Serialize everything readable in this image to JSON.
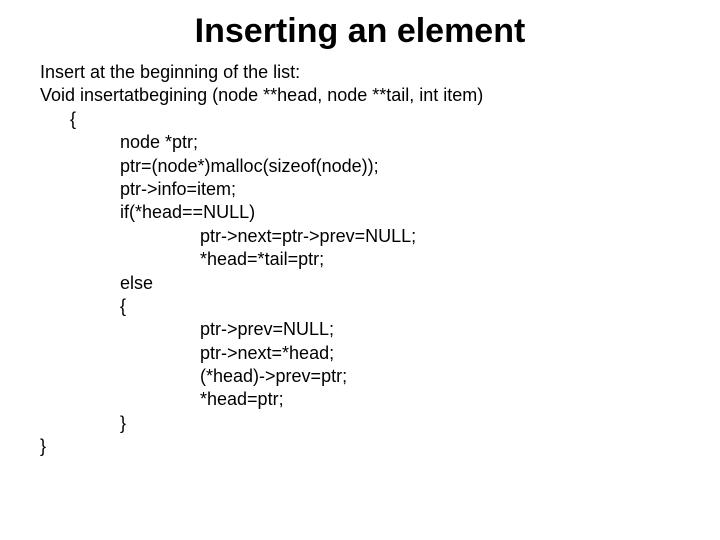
{
  "title": "Inserting an element",
  "intro": "Insert at the beginning of the list:",
  "sig": "Void insertatbegining (node **head, node **tail, int item)",
  "brace_open": "{",
  "c1": "node *ptr;",
  "c2": "ptr=(node*)malloc(sizeof(node));",
  "c3": "ptr->info=item;",
  "c4": "if(*head==NULL)",
  "c5": "ptr->next=ptr->prev=NULL;",
  "c6": "*head=*tail=ptr;",
  "c7": "else",
  "c8": "{",
  "c9": "ptr->prev=NULL;",
  "c10": "ptr->next=*head;",
  "c11": "(*head)->prev=ptr;",
  "c12": "*head=ptr;",
  "c13": "}",
  "brace_close": "}"
}
